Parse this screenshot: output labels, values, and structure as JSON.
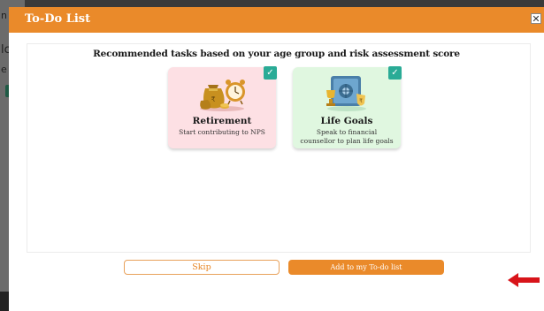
{
  "background": {
    "fragments": [
      "n",
      "lc",
      "e c",
      "P"
    ]
  },
  "modal": {
    "title": "To-Do List",
    "close_label": "✕",
    "subtitle": "Recommended tasks based on your age group and risk assessment score",
    "cards": [
      {
        "title": "Retirement",
        "description": "Start contributing to NPS",
        "checked": true,
        "icon": "money-bags-clock-icon"
      },
      {
        "title": "Life Goals",
        "description_lines": [
          "Speak to financial",
          "counsellor to plan life goals"
        ],
        "checked": true,
        "icon": "vault-trophy-icon"
      }
    ],
    "check_mark": "✓",
    "skip_label": "Skip",
    "add_label": "Add to my To-do list"
  },
  "colors": {
    "accent": "#ea8a2a",
    "check": "#2aab96",
    "retirement_card": "#fde0e4",
    "lifegoals_card": "#e0f7e0",
    "arrow": "#d8141a"
  }
}
